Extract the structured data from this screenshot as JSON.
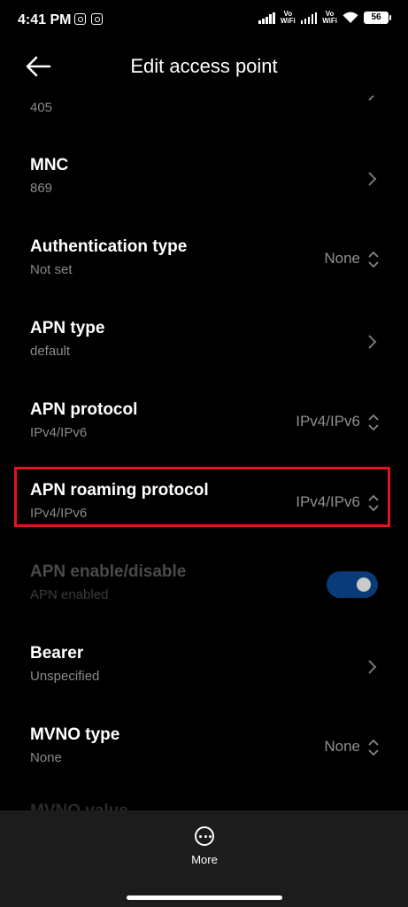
{
  "status_bar": {
    "time": "4:41 PM",
    "app_icons": [
      "instagram-icon",
      "instagram-icon"
    ],
    "vowifi_label_1": "Vo\nWiFi",
    "vowifi_label_2": "Vo\nWiFi",
    "battery": "56"
  },
  "header": {
    "title": "Edit access point",
    "back_icon": "back-arrow-icon"
  },
  "partial_row": {
    "subtitle": "405"
  },
  "rows": [
    {
      "id": "mnc",
      "title": "MNC",
      "subtitle": "869",
      "control": "chevron"
    },
    {
      "id": "authentication-type",
      "title": "Authentication type",
      "subtitle": "Not set",
      "value": "None",
      "control": "dropdown"
    },
    {
      "id": "apn-type",
      "title": "APN type",
      "subtitle": "default",
      "control": "chevron"
    },
    {
      "id": "apn-protocol",
      "title": "APN protocol",
      "subtitle": "IPv4/IPv6",
      "value": "IPv4/IPv6",
      "control": "dropdown"
    },
    {
      "id": "apn-roaming-protocol",
      "title": "APN roaming protocol",
      "subtitle": "IPv4/IPv6",
      "value": "IPv4/IPv6",
      "control": "dropdown",
      "highlighted": true
    },
    {
      "id": "apn-enable-disable",
      "title": "APN enable/disable",
      "subtitle": "APN enabled",
      "control": "toggle",
      "toggle_on": true,
      "disabled": true
    },
    {
      "id": "bearer",
      "title": "Bearer",
      "subtitle": "Unspecified",
      "control": "chevron"
    },
    {
      "id": "mvno-type",
      "title": "MVNO type",
      "subtitle": "None",
      "value": "None",
      "control": "dropdown"
    }
  ],
  "faded_row": {
    "title": "MVNO value"
  },
  "bottom_bar": {
    "more_label": "More",
    "more_icon": "more-options-icon"
  },
  "colors": {
    "background": "#000000",
    "bottom_bar": "#1c1c1c",
    "highlight_border": "#e0151d",
    "toggle_track": "#0b3a78"
  }
}
